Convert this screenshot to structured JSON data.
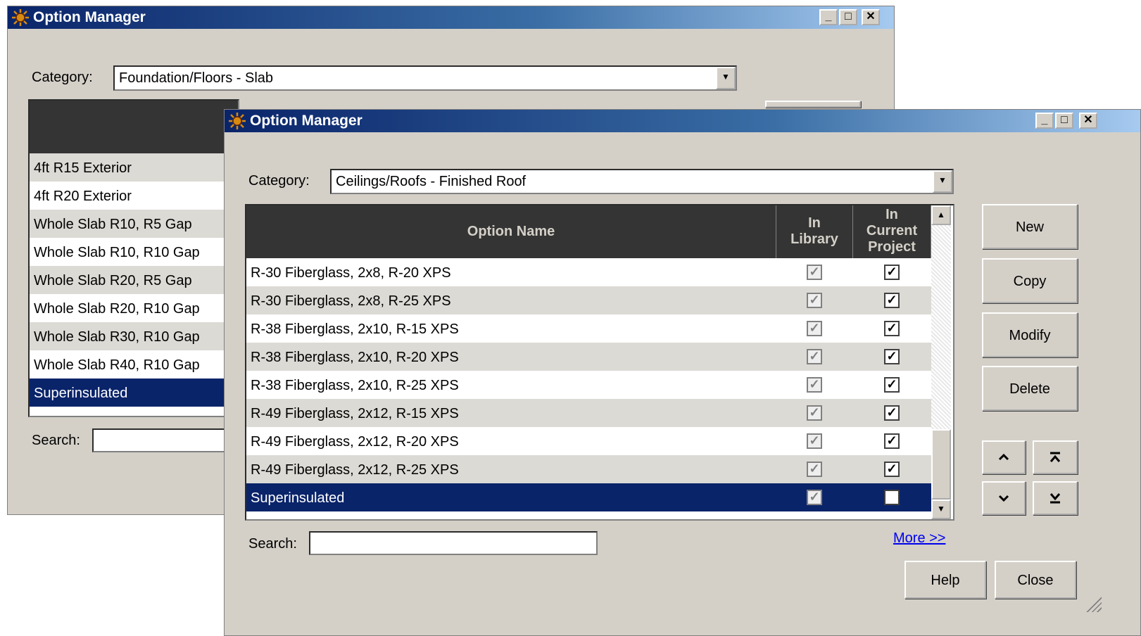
{
  "back_window": {
    "title": "Option Manager",
    "category_label": "Category:",
    "category_value": "Foundation/Floors - Slab",
    "rows": [
      {
        "name": "4ft R15 Exterior"
      },
      {
        "name": "4ft R20 Exterior"
      },
      {
        "name": "Whole Slab R10, R5 Gap"
      },
      {
        "name": "Whole Slab R10, R10 Gap"
      },
      {
        "name": "Whole Slab R20, R5 Gap"
      },
      {
        "name": "Whole Slab R20, R10 Gap"
      },
      {
        "name": "Whole Slab R30, R10 Gap"
      },
      {
        "name": "Whole Slab R40, R10 Gap"
      },
      {
        "name": "Superinsulated"
      }
    ],
    "selected_row": "Superinsulated",
    "search_label": "Search:",
    "search_value": ""
  },
  "front_window": {
    "title": "Option Manager",
    "category_label": "Category:",
    "category_value": "Ceilings/Roofs - Finished Roof",
    "columns": {
      "name": "Option Name",
      "in_library_1": "In",
      "in_library_2": "Library",
      "in_project_1": "In",
      "in_project_2": "Current",
      "in_project_3": "Project"
    },
    "rows": [
      {
        "name": "R-30 Fiberglass, 2x8, R-20 XPS",
        "in_library": true,
        "in_project": true
      },
      {
        "name": "R-30 Fiberglass, 2x8, R-25 XPS",
        "in_library": true,
        "in_project": true
      },
      {
        "name": "R-38 Fiberglass, 2x10, R-15 XPS",
        "in_library": true,
        "in_project": true
      },
      {
        "name": "R-38 Fiberglass, 2x10, R-20 XPS",
        "in_library": true,
        "in_project": true
      },
      {
        "name": "R-38 Fiberglass, 2x10, R-25 XPS",
        "in_library": true,
        "in_project": true
      },
      {
        "name": "R-49 Fiberglass, 2x12, R-15 XPS",
        "in_library": true,
        "in_project": true
      },
      {
        "name": "R-49 Fiberglass, 2x12, R-20 XPS",
        "in_library": true,
        "in_project": true
      },
      {
        "name": "R-49 Fiberglass, 2x12, R-25 XPS",
        "in_library": true,
        "in_project": true
      },
      {
        "name": "Superinsulated",
        "in_library": true,
        "in_project": false
      }
    ],
    "selected_row": "Superinsulated",
    "buttons": {
      "new": "New",
      "copy": "Copy",
      "modify": "Modify",
      "delete": "Delete",
      "help": "Help",
      "close": "Close"
    },
    "move_icons": [
      "move-up-icon",
      "move-top-icon",
      "move-down-icon",
      "move-bottom-icon"
    ],
    "search_label": "Search:",
    "search_value": "",
    "more_link": "More >>"
  },
  "colors": {
    "title_start": "#0a246a",
    "title_end": "#a6caf0",
    "header_bg": "#343434",
    "selection": "#0a246a",
    "alt_row": "#dcdad5",
    "link": "#0000ee",
    "face": "#d4d0c8"
  }
}
